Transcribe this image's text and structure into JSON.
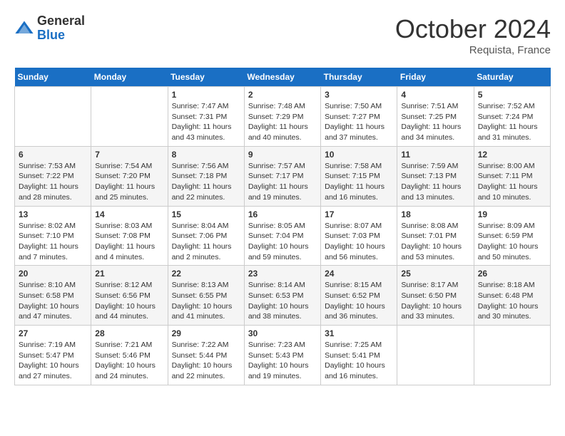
{
  "logo": {
    "general": "General",
    "blue": "Blue"
  },
  "title": "October 2024",
  "location": "Requista, France",
  "days_of_week": [
    "Sunday",
    "Monday",
    "Tuesday",
    "Wednesday",
    "Thursday",
    "Friday",
    "Saturday"
  ],
  "weeks": [
    [
      {
        "num": "",
        "info": ""
      },
      {
        "num": "",
        "info": ""
      },
      {
        "num": "1",
        "info": "Sunrise: 7:47 AM\nSunset: 7:31 PM\nDaylight: 11 hours and 43 minutes."
      },
      {
        "num": "2",
        "info": "Sunrise: 7:48 AM\nSunset: 7:29 PM\nDaylight: 11 hours and 40 minutes."
      },
      {
        "num": "3",
        "info": "Sunrise: 7:50 AM\nSunset: 7:27 PM\nDaylight: 11 hours and 37 minutes."
      },
      {
        "num": "4",
        "info": "Sunrise: 7:51 AM\nSunset: 7:25 PM\nDaylight: 11 hours and 34 minutes."
      },
      {
        "num": "5",
        "info": "Sunrise: 7:52 AM\nSunset: 7:24 PM\nDaylight: 11 hours and 31 minutes."
      }
    ],
    [
      {
        "num": "6",
        "info": "Sunrise: 7:53 AM\nSunset: 7:22 PM\nDaylight: 11 hours and 28 minutes."
      },
      {
        "num": "7",
        "info": "Sunrise: 7:54 AM\nSunset: 7:20 PM\nDaylight: 11 hours and 25 minutes."
      },
      {
        "num": "8",
        "info": "Sunrise: 7:56 AM\nSunset: 7:18 PM\nDaylight: 11 hours and 22 minutes."
      },
      {
        "num": "9",
        "info": "Sunrise: 7:57 AM\nSunset: 7:17 PM\nDaylight: 11 hours and 19 minutes."
      },
      {
        "num": "10",
        "info": "Sunrise: 7:58 AM\nSunset: 7:15 PM\nDaylight: 11 hours and 16 minutes."
      },
      {
        "num": "11",
        "info": "Sunrise: 7:59 AM\nSunset: 7:13 PM\nDaylight: 11 hours and 13 minutes."
      },
      {
        "num": "12",
        "info": "Sunrise: 8:00 AM\nSunset: 7:11 PM\nDaylight: 11 hours and 10 minutes."
      }
    ],
    [
      {
        "num": "13",
        "info": "Sunrise: 8:02 AM\nSunset: 7:10 PM\nDaylight: 11 hours and 7 minutes."
      },
      {
        "num": "14",
        "info": "Sunrise: 8:03 AM\nSunset: 7:08 PM\nDaylight: 11 hours and 4 minutes."
      },
      {
        "num": "15",
        "info": "Sunrise: 8:04 AM\nSunset: 7:06 PM\nDaylight: 11 hours and 2 minutes."
      },
      {
        "num": "16",
        "info": "Sunrise: 8:05 AM\nSunset: 7:04 PM\nDaylight: 10 hours and 59 minutes."
      },
      {
        "num": "17",
        "info": "Sunrise: 8:07 AM\nSunset: 7:03 PM\nDaylight: 10 hours and 56 minutes."
      },
      {
        "num": "18",
        "info": "Sunrise: 8:08 AM\nSunset: 7:01 PM\nDaylight: 10 hours and 53 minutes."
      },
      {
        "num": "19",
        "info": "Sunrise: 8:09 AM\nSunset: 6:59 PM\nDaylight: 10 hours and 50 minutes."
      }
    ],
    [
      {
        "num": "20",
        "info": "Sunrise: 8:10 AM\nSunset: 6:58 PM\nDaylight: 10 hours and 47 minutes."
      },
      {
        "num": "21",
        "info": "Sunrise: 8:12 AM\nSunset: 6:56 PM\nDaylight: 10 hours and 44 minutes."
      },
      {
        "num": "22",
        "info": "Sunrise: 8:13 AM\nSunset: 6:55 PM\nDaylight: 10 hours and 41 minutes."
      },
      {
        "num": "23",
        "info": "Sunrise: 8:14 AM\nSunset: 6:53 PM\nDaylight: 10 hours and 38 minutes."
      },
      {
        "num": "24",
        "info": "Sunrise: 8:15 AM\nSunset: 6:52 PM\nDaylight: 10 hours and 36 minutes."
      },
      {
        "num": "25",
        "info": "Sunrise: 8:17 AM\nSunset: 6:50 PM\nDaylight: 10 hours and 33 minutes."
      },
      {
        "num": "26",
        "info": "Sunrise: 8:18 AM\nSunset: 6:48 PM\nDaylight: 10 hours and 30 minutes."
      }
    ],
    [
      {
        "num": "27",
        "info": "Sunrise: 7:19 AM\nSunset: 5:47 PM\nDaylight: 10 hours and 27 minutes."
      },
      {
        "num": "28",
        "info": "Sunrise: 7:21 AM\nSunset: 5:46 PM\nDaylight: 10 hours and 24 minutes."
      },
      {
        "num": "29",
        "info": "Sunrise: 7:22 AM\nSunset: 5:44 PM\nDaylight: 10 hours and 22 minutes."
      },
      {
        "num": "30",
        "info": "Sunrise: 7:23 AM\nSunset: 5:43 PM\nDaylight: 10 hours and 19 minutes."
      },
      {
        "num": "31",
        "info": "Sunrise: 7:25 AM\nSunset: 5:41 PM\nDaylight: 10 hours and 16 minutes."
      },
      {
        "num": "",
        "info": ""
      },
      {
        "num": "",
        "info": ""
      }
    ]
  ]
}
